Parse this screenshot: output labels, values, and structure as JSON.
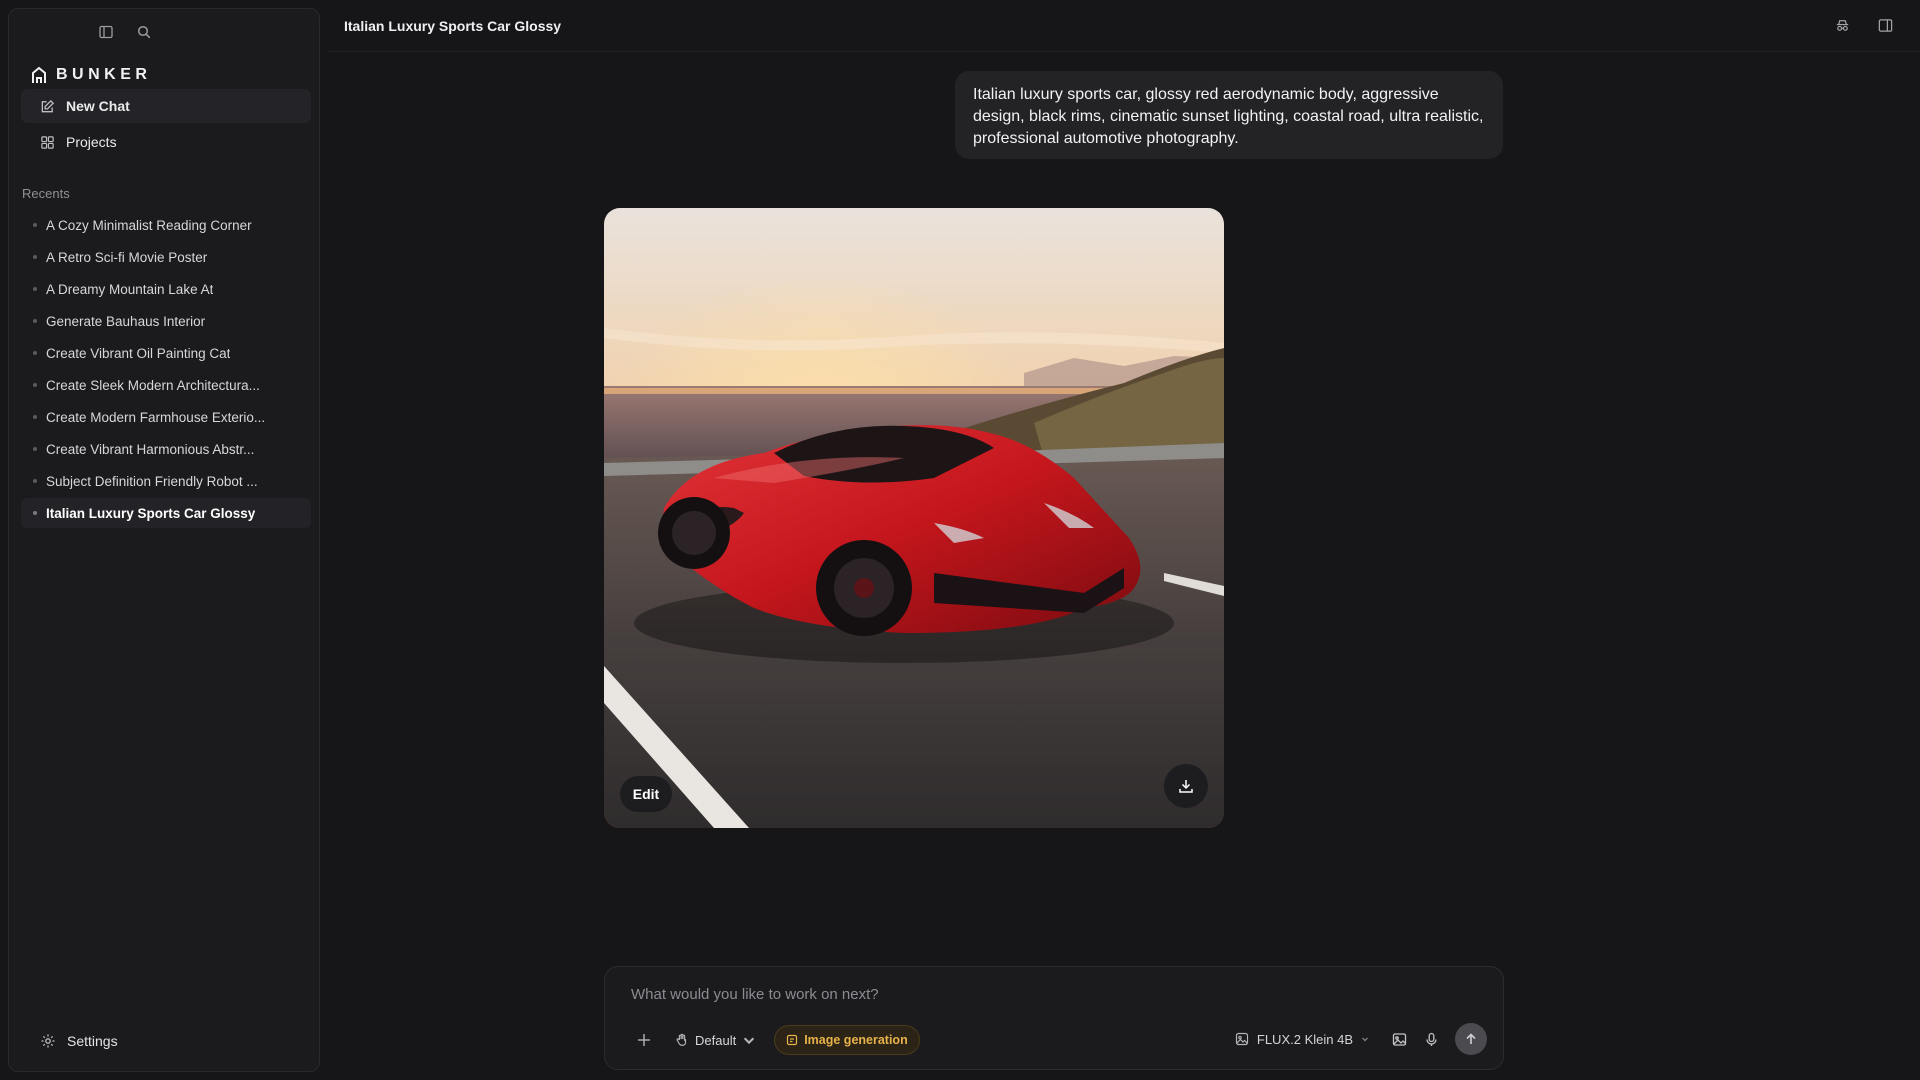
{
  "app": {
    "brand": "BUNKER"
  },
  "sidebar": {
    "nav": [
      {
        "label": "New Chat",
        "icon": "edit-icon"
      },
      {
        "label": "Projects",
        "icon": "grid-icon"
      }
    ],
    "recents_title": "Recents",
    "recents": [
      {
        "label": "A Cozy Minimalist Reading Corner",
        "active": false
      },
      {
        "label": "A Retro Sci-fi Movie Poster",
        "active": false
      },
      {
        "label": "A Dreamy Mountain Lake At",
        "active": false
      },
      {
        "label": "Generate Bauhaus Interior",
        "active": false
      },
      {
        "label": "Create Vibrant Oil Painting Cat",
        "active": false
      },
      {
        "label": "Create Sleek Modern Architectura...",
        "active": false
      },
      {
        "label": "Create Modern Farmhouse Exterio...",
        "active": false
      },
      {
        "label": "Create Vibrant Harmonious Abstr...",
        "active": false
      },
      {
        "label": "Subject Definition Friendly Robot ...",
        "active": false
      },
      {
        "label": "Italian Luxury Sports Car Glossy",
        "active": true
      }
    ],
    "settings_label": "Settings"
  },
  "header": {
    "title": "Italian Luxury Sports Car Glossy"
  },
  "conversation": {
    "user_message": "Italian luxury sports car, glossy red aerodynamic body, aggressive design, black rims, cinematic sunset lighting, coastal road, ultra realistic, professional automotive photography.",
    "image": {
      "edit_label": "Edit"
    }
  },
  "composer": {
    "placeholder": "What would you like to work on next?",
    "mode_label": "Default",
    "image_gen_label": "Image generation",
    "model_label": "FLUX.2 Klein 4B"
  },
  "colors": {
    "background": "#161618",
    "sidebar": "#1b1b1e",
    "accent": "#e8b24a",
    "car_red": "#c4161c"
  }
}
